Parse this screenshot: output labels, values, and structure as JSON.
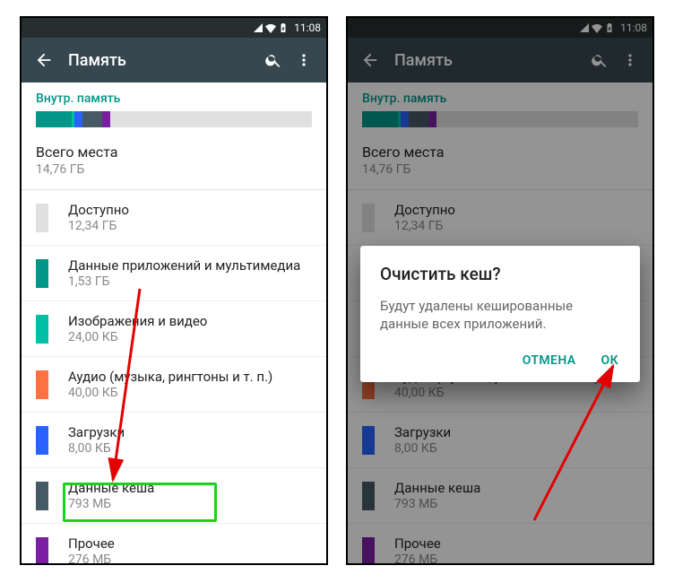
{
  "status": {
    "time": "11:08"
  },
  "appbar": {
    "title": "Память"
  },
  "subheader": "Внутр. память",
  "total": {
    "label": "Всего места",
    "value": "14,76 ГБ"
  },
  "rows": [
    {
      "label": "Доступно",
      "value": "12,34 ГБ",
      "color": "#e0e0e0"
    },
    {
      "label": "Данные приложений и мультимедиа",
      "value": "1,53 ГБ",
      "color": "#009688"
    },
    {
      "label": "Изображения и видео",
      "value": "24,00 КБ",
      "color": "#00bfa5"
    },
    {
      "label": "Аудио (музыка, рингтоны и т. п.)",
      "value": "40,00 КБ",
      "color": "#ff7043"
    },
    {
      "label": "Загрузки",
      "value": "8,00 КБ",
      "color": "#2962ff"
    },
    {
      "label": "Данные кеша",
      "value": "793 МБ",
      "color": "#455a64"
    },
    {
      "label": "Прочее",
      "value": "276 МБ",
      "color": "#7b1fa2"
    }
  ],
  "usage_segments": [
    {
      "color": "#009688",
      "pct": 13
    },
    {
      "color": "#00bfa5",
      "pct": 1
    },
    {
      "color": "#2962ff",
      "pct": 3
    },
    {
      "color": "#455a64",
      "pct": 7
    },
    {
      "color": "#7b1fa2",
      "pct": 3
    }
  ],
  "dialog": {
    "title": "Очистить кеш?",
    "message": "Будут удалены кешированные данные всех приложений.",
    "cancel": "ОТМЕНА",
    "ok": "ОК"
  }
}
